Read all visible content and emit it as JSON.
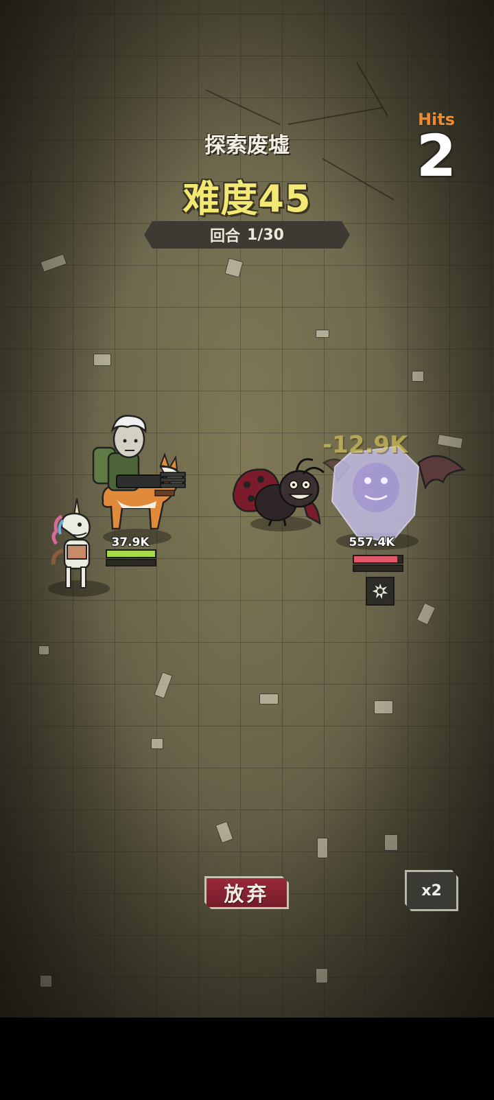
{
  "header": {
    "stage_title": "探索废墟",
    "difficulty_label": "难度45",
    "round_label": "回合",
    "round_value": "1/30"
  },
  "hits": {
    "label": "Hits",
    "value": "2"
  },
  "player": {
    "hp": "37.9K",
    "hp_fraction": 1.0,
    "hp_color": "#a8d94a",
    "characters": [
      "old-man-gunner",
      "corgi-mount",
      "unicorn-pet"
    ]
  },
  "enemy": {
    "hp": "557.4K",
    "hp_fraction": 0.9,
    "hp_color": "#e0586a",
    "characters": [
      "ladybug",
      "ghost-bat"
    ],
    "status_icon": "spiky-burst-icon"
  },
  "damage_popup": "-12.9K",
  "buttons": {
    "give_up": "放弃",
    "speed": "x2"
  },
  "colors": {
    "accent_yellow": "#f3e873",
    "hits_orange": "#f08a2a",
    "button_red": "#8a2333"
  }
}
